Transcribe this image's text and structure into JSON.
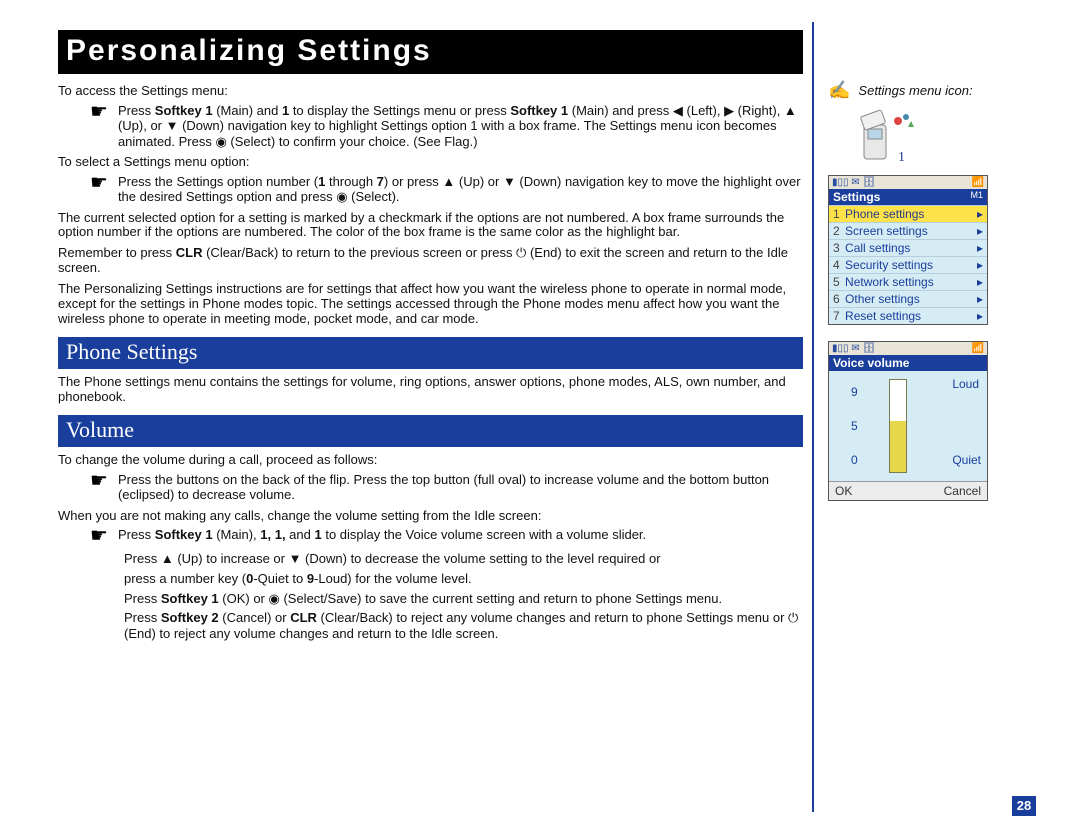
{
  "page_number": "28",
  "title": "Personalizing Settings",
  "access_intro": "To access the Settings menu:",
  "access_bullet_1_a": "Press ",
  "access_bullet_1_sk1": "Softkey 1",
  "access_bullet_1_b": " (Main) and ",
  "access_bullet_1_one": "1",
  "access_bullet_1_c": " to display the Settings menu or press ",
  "access_bullet_1_sk1b": "Softkey 1",
  "access_bullet_1_d": " (Main) and press ◀ (Left), ▶ (Right), ▲ (Up), or ▼ (Down) navigation key to highlight Settings option 1 with a box frame. The Settings menu icon becomes animated. Press ◉ (Select) to confirm your choice. (See Flag.)",
  "select_intro": "To select a Settings menu option:",
  "select_bullet_a": "Press the Settings option number (",
  "select_bullet_b": "1",
  "select_bullet_c": " through ",
  "select_bullet_d": "7",
  "select_bullet_e": ") or press ▲ (Up) or ▼ (Down) navigation key to move the highlight over the desired Settings option and press ◉ (Select).",
  "para_checkmark": "The current selected option for a setting is marked by a checkmark if the options are not numbered. A box frame surrounds the option number if the options are numbered. The color of the box frame is the same color as the highlight bar.",
  "para_clr_a": "Remember to press ",
  "para_clr_b": "CLR",
  "para_clr_c": " (Clear/Back) to return to the previous screen or press ⏻ (End) to exit the screen and return to the Idle screen.",
  "para_personalizing": "The Personalizing Settings instructions are for settings that affect how you want the wireless phone to operate in normal mode, except for the settings in Phone modes topic. The settings accessed through the Phone modes menu affect how you want the wireless phone to operate in meeting mode, pocket mode, and car mode.",
  "h_phone_settings": "Phone Settings",
  "phone_settings_para": "The Phone settings menu contains the settings for volume, ring options, answer options, phone modes, ALS, own number, and phonebook.",
  "h_volume": "Volume",
  "vol_para1": "To change the volume during a call, proceed as follows:",
  "vol_bullet1": "Press the buttons on the back of the flip. Press the top button (full oval) to increase volume and the bottom button (eclipsed) to decrease volume.",
  "vol_para2": "When you are not making any calls, change the volume setting from the Idle screen:",
  "vol_b2_a": "Press ",
  "vol_b2_sk1": "Softkey 1",
  "vol_b2_b": " (Main), ",
  "vol_b2_nums": "1, 1,",
  "vol_b2_c": " and ",
  "vol_b2_one": "1",
  "vol_b2_d": " to display the Voice volume screen with a volume slider.",
  "vol_sub1": "Press ▲ (Up) to increase or ▼ (Down) to decrease the volume setting to the level required or",
  "vol_sub2_a": "press a number key (",
  "vol_sub2_b": "0",
  "vol_sub2_c": "-Quiet to ",
  "vol_sub2_d": "9",
  "vol_sub2_e": "-Loud) for the volume level.",
  "vol_sub3_a": "Press ",
  "vol_sub3_sk1": "Softkey 1",
  "vol_sub3_b": " (OK) or ◉ (Select/Save) to save the current setting and return to phone Settings menu.",
  "vol_sub4_a": "Press ",
  "vol_sub4_sk2": "Softkey 2",
  "vol_sub4_b": " (Cancel) or ",
  "vol_sub4_clr": "CLR",
  "vol_sub4_c": " (Clear/Back) to reject any volume changes and return to phone Settings menu or ⏻ (End) to reject any volume changes and return to the Idle screen.",
  "side": {
    "label": "Settings menu icon:",
    "screen1": {
      "title": "Settings",
      "tag": "M1",
      "items": [
        {
          "n": "1",
          "label": "Phone settings",
          "sel": true
        },
        {
          "n": "2",
          "label": "Screen settings"
        },
        {
          "n": "3",
          "label": "Call settings"
        },
        {
          "n": "4",
          "label": "Security settings"
        },
        {
          "n": "5",
          "label": "Network settings"
        },
        {
          "n": "6",
          "label": "Other settings"
        },
        {
          "n": "7",
          "label": "Reset settings"
        }
      ]
    },
    "screen2": {
      "title": "Voice volume",
      "loud": "Loud",
      "quiet": "Quiet",
      "v9": "9",
      "v5": "5",
      "v0": "0",
      "ok": "OK",
      "cancel": "Cancel"
    }
  }
}
